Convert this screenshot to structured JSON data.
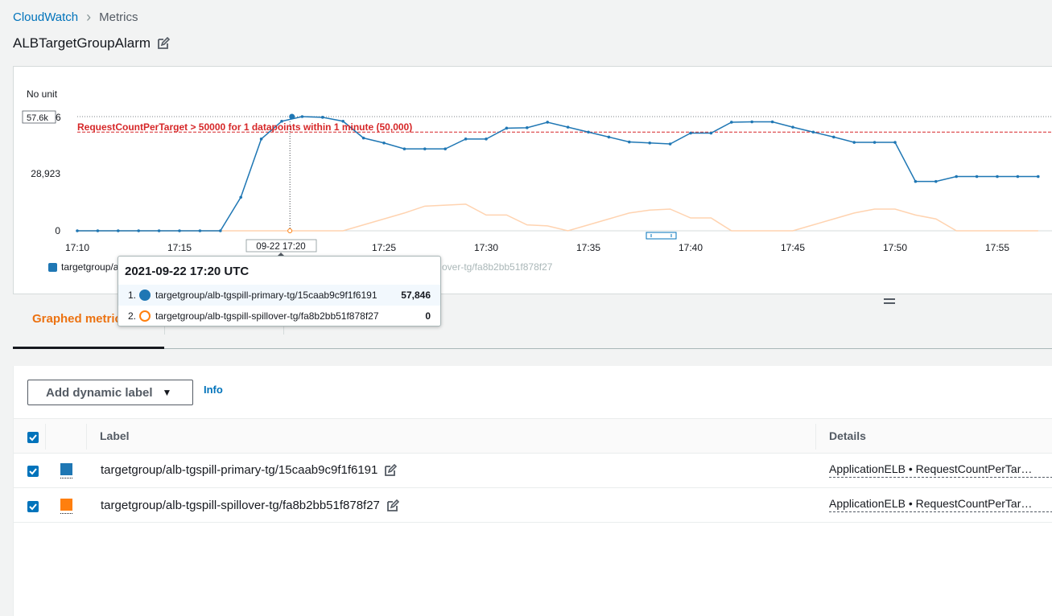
{
  "breadcrumb": {
    "root": "CloudWatch",
    "current": "Metrics"
  },
  "page": {
    "title": "ALBTargetGroupAlarm"
  },
  "chart": {
    "y_unit": "No unit",
    "y_ticks": [
      "0",
      "28,923"
    ],
    "y_max_tag": "57.6k",
    "y_max_tail": "6",
    "threshold_label": "RequestCountPerTarget > 50000 for 1 datapoints within 1 minute (50,000)",
    "x_ticks": [
      "17:10",
      "17:15",
      "17:25",
      "17:30",
      "17:35",
      "17:40",
      "17:45",
      "17:50",
      "17:55"
    ],
    "cursor_label": "09-22 17:20",
    "legend": [
      {
        "name": "targetgroup/a",
        "color": "#1f77b4"
      },
      {
        "name": "over-tg/fa8b2bb51f878f27",
        "color": "#ff7f0e"
      }
    ],
    "colors": {
      "primary": "#1f77b4",
      "spillover": "#ff7f0e",
      "threshold": "#d62728"
    }
  },
  "chart_data": {
    "type": "line",
    "title": "",
    "ylabel": "No unit",
    "ylim": [
      0,
      57846
    ],
    "threshold": 50000,
    "x": [
      "17:10",
      "17:11",
      "17:12",
      "17:13",
      "17:14",
      "17:15",
      "17:16",
      "17:17",
      "17:18",
      "17:19",
      "17:20",
      "17:21",
      "17:22",
      "17:23",
      "17:24",
      "17:25",
      "17:26",
      "17:27",
      "17:28",
      "17:29",
      "17:30",
      "17:31",
      "17:32",
      "17:33",
      "17:34",
      "17:35",
      "17:36",
      "17:37",
      "17:38",
      "17:39",
      "17:40",
      "17:41",
      "17:42",
      "17:43",
      "17:44",
      "17:45",
      "17:46",
      "17:47",
      "17:48",
      "17:49",
      "17:50",
      "17:51",
      "17:52",
      "17:53",
      "17:54",
      "17:55",
      "17:56"
    ],
    "series": [
      {
        "name": "targetgroup/alb-tgspill-primary-tg/15caab9c9f1f6191",
        "values": [
          0,
          0,
          0,
          0,
          0,
          0,
          0,
          0,
          17000,
          46500,
          55500,
          57846,
          57500,
          55500,
          47000,
          44500,
          41500,
          41500,
          41500,
          46500,
          46500,
          52000,
          52200,
          55000,
          52500,
          50000,
          47500,
          45000,
          44500,
          44000,
          49500,
          49500,
          55000,
          55200,
          55200,
          52500,
          50000,
          47500,
          44800,
          44800,
          44800,
          25000,
          25000,
          27500,
          27500,
          27500,
          27500,
          27500
        ]
      },
      {
        "name": "targetgroup/alb-tgspill-spillover-tg/fa8b2bb51f878f27",
        "values": [
          0,
          0,
          0,
          0,
          0,
          0,
          0,
          0,
          0,
          0,
          0,
          0,
          0,
          0,
          3000,
          6000,
          9000,
          12500,
          13000,
          13500,
          8000,
          8000,
          3000,
          2500,
          0,
          3000,
          6000,
          9000,
          10500,
          11000,
          6500,
          6500,
          0,
          0,
          0,
          0,
          3000,
          6000,
          9000,
          11000,
          11000,
          8000,
          6000,
          0,
          0,
          0,
          0,
          0
        ]
      }
    ]
  },
  "tooltip": {
    "title": "2021-09-22 17:20 UTC",
    "rows": [
      {
        "index": "1.",
        "name": "targetgroup/alb-tgspill-primary-tg/15caab9c9f1f6191",
        "value": "57,846",
        "color": "#1f77b4"
      },
      {
        "index": "2.",
        "name": "targetgroup/alb-tgspill-spillover-tg/fa8b2bb51f878f27",
        "value": "0",
        "color": "#ff7f0e"
      }
    ]
  },
  "tabs": {
    "active": "Graphed metric"
  },
  "metrics": {
    "add_label_button": "Add dynamic label",
    "info": "Info",
    "columns": {
      "label": "Label",
      "details": "Details"
    },
    "rows": [
      {
        "label": "targetgroup/alb-tgspill-primary-tg/15caab9c9f1f6191",
        "details": "ApplicationELB • RequestCountPerTar…",
        "color": "#1f77b4",
        "checked": true
      },
      {
        "label": "targetgroup/alb-tgspill-spillover-tg/fa8b2bb51f878f27",
        "details": "ApplicationELB • RequestCountPerTar…",
        "color": "#ff7f0e",
        "checked": true
      }
    ]
  }
}
